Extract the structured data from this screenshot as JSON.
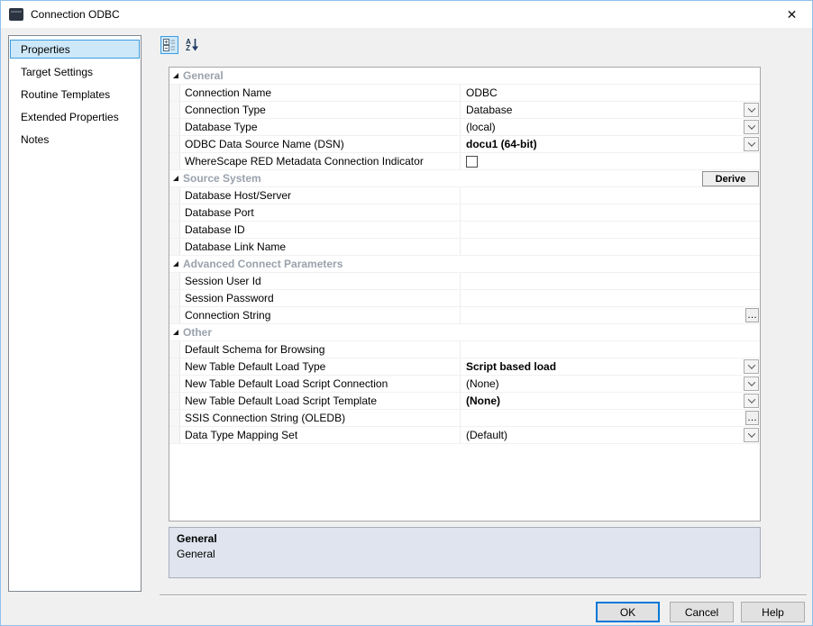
{
  "window": {
    "title": "Connection ODBC",
    "close_glyph": "✕"
  },
  "sidebar": {
    "items": [
      {
        "label": "Properties",
        "selected": true
      },
      {
        "label": "Target Settings",
        "selected": false
      },
      {
        "label": "Routine Templates",
        "selected": false
      },
      {
        "label": "Extended Properties",
        "selected": false
      },
      {
        "label": "Notes",
        "selected": false
      }
    ]
  },
  "toolbar": {
    "sort_letter_top": "A",
    "sort_letter_bottom": "Z"
  },
  "grid": {
    "sections": [
      {
        "title": "General",
        "rows": [
          {
            "label": "Connection Name",
            "value": "ODBC",
            "bold": false,
            "control": "none"
          },
          {
            "label": "Connection Type",
            "value": "Database",
            "bold": false,
            "control": "dropdown"
          },
          {
            "label": "Database Type",
            "value": "(local)",
            "bold": false,
            "control": "dropdown"
          },
          {
            "label": "ODBC Data Source Name (DSN)",
            "value": "docu1 (64-bit)",
            "bold": true,
            "control": "dropdown"
          },
          {
            "label": "WhereScape RED Metadata Connection Indicator",
            "value": "",
            "bold": false,
            "control": "checkbox",
            "checked": false
          }
        ]
      },
      {
        "title": "Source System",
        "button": "Derive",
        "rows": [
          {
            "label": "Database Host/Server",
            "value": "",
            "bold": false,
            "control": "none"
          },
          {
            "label": "Database Port",
            "value": "",
            "bold": false,
            "control": "none"
          },
          {
            "label": "Database ID",
            "value": "",
            "bold": false,
            "control": "none"
          },
          {
            "label": "Database Link Name",
            "value": "",
            "bold": false,
            "control": "none"
          }
        ]
      },
      {
        "title": "Advanced Connect Parameters",
        "rows": [
          {
            "label": "Session User Id",
            "value": "",
            "bold": false,
            "control": "none"
          },
          {
            "label": "Session Password",
            "value": "",
            "bold": false,
            "control": "none"
          },
          {
            "label": "Connection String",
            "value": "",
            "bold": false,
            "control": "ellipsis"
          }
        ]
      },
      {
        "title": "Other",
        "rows": [
          {
            "label": "Default Schema for Browsing",
            "value": "",
            "bold": false,
            "control": "none"
          },
          {
            "label": "New Table Default Load Type",
            "value": "Script based load",
            "bold": true,
            "control": "dropdown"
          },
          {
            "label": "New Table Default Load Script Connection",
            "value": "(None)",
            "bold": false,
            "control": "dropdown"
          },
          {
            "label": "New Table Default Load Script Template",
            "value": "(None)",
            "bold": true,
            "control": "dropdown"
          },
          {
            "label": "SSIS Connection String (OLEDB)",
            "value": "",
            "bold": false,
            "control": "ellipsis"
          },
          {
            "label": "Data Type Mapping Set",
            "value": "(Default)",
            "bold": false,
            "control": "dropdown"
          }
        ]
      }
    ]
  },
  "description": {
    "title": "General",
    "text": "General"
  },
  "footer": {
    "ok": "OK",
    "cancel": "Cancel",
    "help": "Help"
  },
  "colors": {
    "selection_bg": "#cde8f9",
    "selection_border": "#3c9ce0",
    "category_text": "#9aa2ac",
    "description_bg": "#dfe4ee",
    "accent": "#0078d7",
    "window_border": "#8fc0ea"
  }
}
